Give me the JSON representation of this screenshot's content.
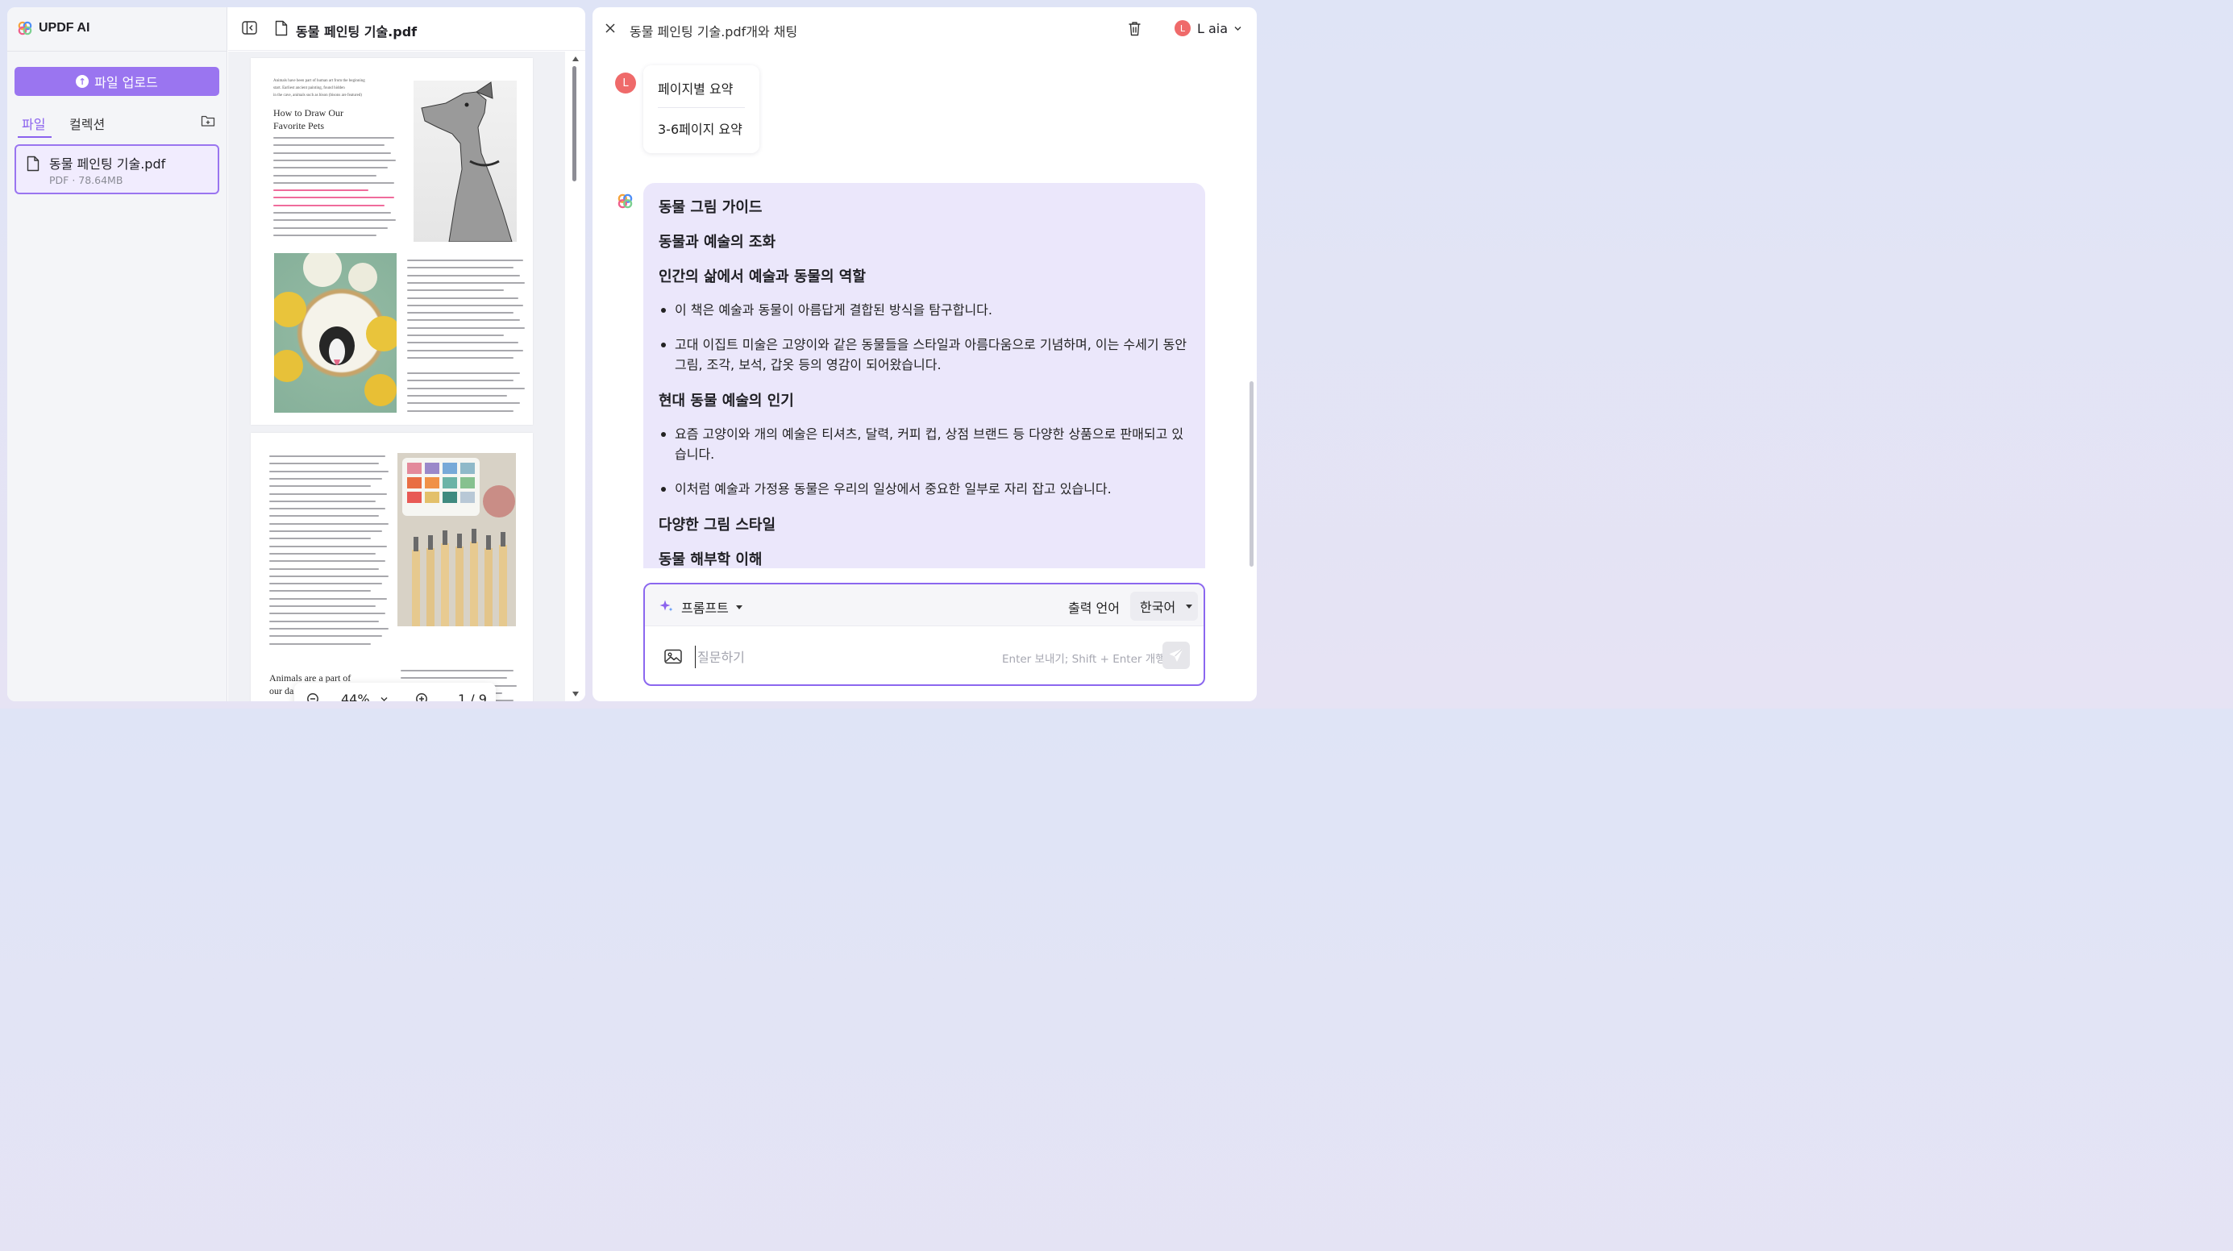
{
  "app": {
    "name": "UPDF AI"
  },
  "sidebar": {
    "upload_label": "파일 업로드",
    "tabs": [
      {
        "label": "파일",
        "active": true
      },
      {
        "label": "컬렉션",
        "active": false
      }
    ],
    "files": [
      {
        "name": "동물 페인팅 기술.pdf",
        "meta": "PDF · 78.64MB"
      }
    ]
  },
  "viewer": {
    "title": "동물 페인팅 기술.pdf",
    "zoom": "44%",
    "page_indicator": "1 / 9",
    "page1_heading": [
      "How to Draw Our",
      "Favorite Pets"
    ],
    "page1_intro": [
      "Animals have been part of human art from the beginning",
      "start. Earliest ancient painting, found hidden",
      "in the cave, animals such as bison (bisons are featured)"
    ],
    "page2_heading": [
      "Animals are a part of",
      "our daily life"
    ]
  },
  "chat": {
    "title": "동물 페인팅 기술.pdf개와 채팅",
    "user_name": "L aia",
    "user_initial": "L",
    "quick_actions": [
      "페이지별 요약",
      "3-6페이지 요약"
    ],
    "answer": {
      "h1": "동물 그림 가이드",
      "h2": "동물과 예술의 조화",
      "h3": "인간의 삶에서 예술과 동물의 역할",
      "b1": "이 책은 예술과 동물이 아름답게 결합된 방식을 탐구합니다.",
      "b2": "고대 이집트 미술은 고양이와 같은 동물들을 스타일과 아름다움으로 기념하며, 이는 수세기 동안 그림, 조각, 보석, 갑옷 등의 영감이 되어왔습니다.",
      "h4": "현대 동물 예술의 인기",
      "b3": "요즘 고양이와 개의 예술은 티셔츠, 달력, 커피 컵, 상점 브랜드 등 다양한 상품으로 판매되고 있습니다.",
      "b4": "이처럼 예술과 가정용 동물은 우리의 일상에서 중요한 일부로 자리 잡고 있습니다.",
      "h5": "다양한 그림 스타일",
      "h6": "동물 해부학 이해"
    },
    "input": {
      "prompt_label": "프롬프트",
      "output_lang_label": "출력 언어",
      "lang_value": "한국어",
      "placeholder": "질문하기",
      "hint": "Enter 보내기; Shift + Enter 개행"
    }
  },
  "colors": {
    "accent": "#9a75f0",
    "avatar": "#ef6a6a",
    "answer_bg": "#ebe7fb",
    "highlight": "#f06b9b"
  }
}
